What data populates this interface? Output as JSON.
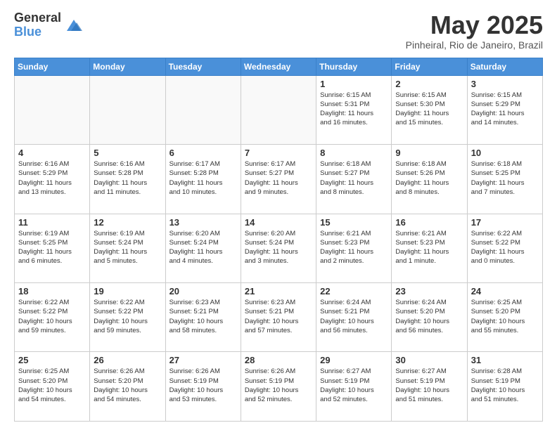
{
  "logo": {
    "general": "General",
    "blue": "Blue"
  },
  "header": {
    "title": "May 2025",
    "subtitle": "Pinheiral, Rio de Janeiro, Brazil"
  },
  "weekdays": [
    "Sunday",
    "Monday",
    "Tuesday",
    "Wednesday",
    "Thursday",
    "Friday",
    "Saturday"
  ],
  "weeks": [
    [
      {
        "day": "",
        "info": ""
      },
      {
        "day": "",
        "info": ""
      },
      {
        "day": "",
        "info": ""
      },
      {
        "day": "",
        "info": ""
      },
      {
        "day": "1",
        "info": "Sunrise: 6:15 AM\nSunset: 5:31 PM\nDaylight: 11 hours\nand 16 minutes."
      },
      {
        "day": "2",
        "info": "Sunrise: 6:15 AM\nSunset: 5:30 PM\nDaylight: 11 hours\nand 15 minutes."
      },
      {
        "day": "3",
        "info": "Sunrise: 6:15 AM\nSunset: 5:29 PM\nDaylight: 11 hours\nand 14 minutes."
      }
    ],
    [
      {
        "day": "4",
        "info": "Sunrise: 6:16 AM\nSunset: 5:29 PM\nDaylight: 11 hours\nand 13 minutes."
      },
      {
        "day": "5",
        "info": "Sunrise: 6:16 AM\nSunset: 5:28 PM\nDaylight: 11 hours\nand 11 minutes."
      },
      {
        "day": "6",
        "info": "Sunrise: 6:17 AM\nSunset: 5:28 PM\nDaylight: 11 hours\nand 10 minutes."
      },
      {
        "day": "7",
        "info": "Sunrise: 6:17 AM\nSunset: 5:27 PM\nDaylight: 11 hours\nand 9 minutes."
      },
      {
        "day": "8",
        "info": "Sunrise: 6:18 AM\nSunset: 5:27 PM\nDaylight: 11 hours\nand 8 minutes."
      },
      {
        "day": "9",
        "info": "Sunrise: 6:18 AM\nSunset: 5:26 PM\nDaylight: 11 hours\nand 8 minutes."
      },
      {
        "day": "10",
        "info": "Sunrise: 6:18 AM\nSunset: 5:25 PM\nDaylight: 11 hours\nand 7 minutes."
      }
    ],
    [
      {
        "day": "11",
        "info": "Sunrise: 6:19 AM\nSunset: 5:25 PM\nDaylight: 11 hours\nand 6 minutes."
      },
      {
        "day": "12",
        "info": "Sunrise: 6:19 AM\nSunset: 5:24 PM\nDaylight: 11 hours\nand 5 minutes."
      },
      {
        "day": "13",
        "info": "Sunrise: 6:20 AM\nSunset: 5:24 PM\nDaylight: 11 hours\nand 4 minutes."
      },
      {
        "day": "14",
        "info": "Sunrise: 6:20 AM\nSunset: 5:24 PM\nDaylight: 11 hours\nand 3 minutes."
      },
      {
        "day": "15",
        "info": "Sunrise: 6:21 AM\nSunset: 5:23 PM\nDaylight: 11 hours\nand 2 minutes."
      },
      {
        "day": "16",
        "info": "Sunrise: 6:21 AM\nSunset: 5:23 PM\nDaylight: 11 hours\nand 1 minute."
      },
      {
        "day": "17",
        "info": "Sunrise: 6:22 AM\nSunset: 5:22 PM\nDaylight: 11 hours\nand 0 minutes."
      }
    ],
    [
      {
        "day": "18",
        "info": "Sunrise: 6:22 AM\nSunset: 5:22 PM\nDaylight: 10 hours\nand 59 minutes."
      },
      {
        "day": "19",
        "info": "Sunrise: 6:22 AM\nSunset: 5:22 PM\nDaylight: 10 hours\nand 59 minutes."
      },
      {
        "day": "20",
        "info": "Sunrise: 6:23 AM\nSunset: 5:21 PM\nDaylight: 10 hours\nand 58 minutes."
      },
      {
        "day": "21",
        "info": "Sunrise: 6:23 AM\nSunset: 5:21 PM\nDaylight: 10 hours\nand 57 minutes."
      },
      {
        "day": "22",
        "info": "Sunrise: 6:24 AM\nSunset: 5:21 PM\nDaylight: 10 hours\nand 56 minutes."
      },
      {
        "day": "23",
        "info": "Sunrise: 6:24 AM\nSunset: 5:20 PM\nDaylight: 10 hours\nand 56 minutes."
      },
      {
        "day": "24",
        "info": "Sunrise: 6:25 AM\nSunset: 5:20 PM\nDaylight: 10 hours\nand 55 minutes."
      }
    ],
    [
      {
        "day": "25",
        "info": "Sunrise: 6:25 AM\nSunset: 5:20 PM\nDaylight: 10 hours\nand 54 minutes."
      },
      {
        "day": "26",
        "info": "Sunrise: 6:26 AM\nSunset: 5:20 PM\nDaylight: 10 hours\nand 54 minutes."
      },
      {
        "day": "27",
        "info": "Sunrise: 6:26 AM\nSunset: 5:19 PM\nDaylight: 10 hours\nand 53 minutes."
      },
      {
        "day": "28",
        "info": "Sunrise: 6:26 AM\nSunset: 5:19 PM\nDaylight: 10 hours\nand 52 minutes."
      },
      {
        "day": "29",
        "info": "Sunrise: 6:27 AM\nSunset: 5:19 PM\nDaylight: 10 hours\nand 52 minutes."
      },
      {
        "day": "30",
        "info": "Sunrise: 6:27 AM\nSunset: 5:19 PM\nDaylight: 10 hours\nand 51 minutes."
      },
      {
        "day": "31",
        "info": "Sunrise: 6:28 AM\nSunset: 5:19 PM\nDaylight: 10 hours\nand 51 minutes."
      }
    ]
  ]
}
